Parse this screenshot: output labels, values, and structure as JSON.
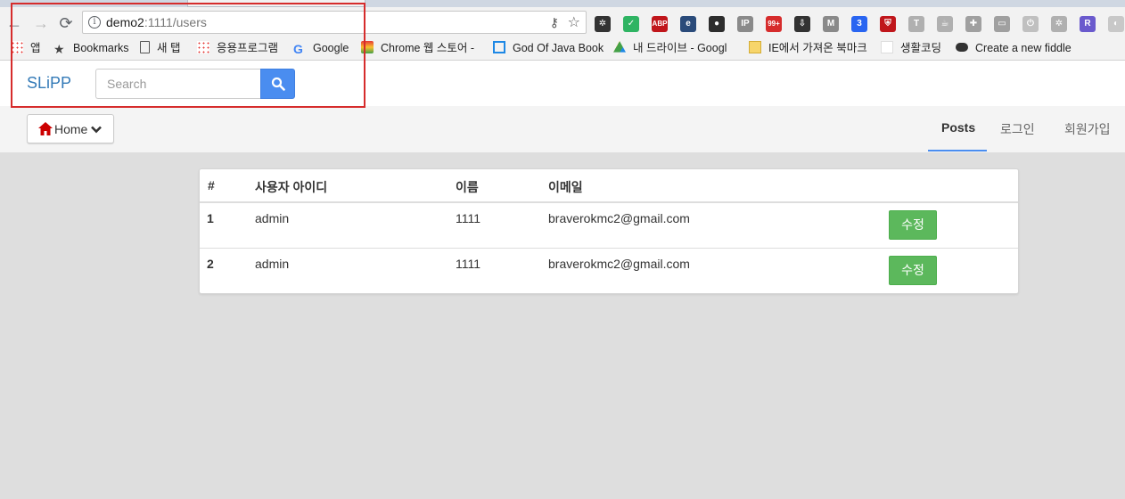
{
  "browser": {
    "url_host": "demo2",
    "url_rest": ":1111/users",
    "nav": {
      "back_icon": "←",
      "forward_icon": "→",
      "reload_icon": "⟳"
    },
    "extensions": [
      {
        "name": "gear-icon",
        "glyph": "✲",
        "color": "#333333"
      },
      {
        "name": "shield-check-icon",
        "glyph": "✓",
        "color": "#2fb463"
      },
      {
        "name": "adblock-icon",
        "glyph": "ABP",
        "color": "#c0161b"
      },
      {
        "name": "e-icon",
        "glyph": "e",
        "color": "#2a4b7a"
      },
      {
        "name": "person-icon",
        "glyph": "●",
        "color": "#2d2d2d"
      },
      {
        "name": "ip-icon",
        "glyph": "IP",
        "color": "#8a8a8a"
      },
      {
        "name": "notification-icon",
        "glyph": "99+",
        "color": "#d62c2c"
      },
      {
        "name": "download-icon",
        "glyph": "⇩",
        "color": "#333333"
      },
      {
        "name": "mail-icon",
        "glyph": "M",
        "color": "#8a8a8a"
      },
      {
        "name": "css3-icon",
        "glyph": "3",
        "color": "#2965f1"
      },
      {
        "name": "security-shield-icon",
        "glyph": "⛨",
        "color": "#c0161b"
      },
      {
        "name": "t-icon",
        "glyph": "T",
        "color": "#b0b0b0"
      },
      {
        "name": "java-icon",
        "glyph": "☕",
        "color": "#b0b0b0"
      },
      {
        "name": "puzzle-icon",
        "glyph": "✚",
        "color": "#a0a0a0"
      },
      {
        "name": "card-icon",
        "glyph": "▭",
        "color": "#a0a0a0"
      },
      {
        "name": "power-icon",
        "glyph": "⏻",
        "color": "#c0c0c0"
      },
      {
        "name": "settings-icon",
        "glyph": "✲",
        "color": "#b0b0b0"
      },
      {
        "name": "r-icon",
        "glyph": "R",
        "color": "#6a5acd"
      },
      {
        "name": "round-icon",
        "glyph": "◐",
        "color": "#c8c8c8"
      }
    ],
    "bookmarks": [
      {
        "label": "앱",
        "icon": "apps-icon"
      },
      {
        "label": "Bookmarks",
        "icon": "star-icon"
      },
      {
        "label": "새 탭",
        "icon": "page-icon"
      },
      {
        "label": "응용프로그램",
        "icon": "apps-icon"
      },
      {
        "label": "Google",
        "icon": "google-icon"
      },
      {
        "label": "Chrome 웹 스토어 -",
        "icon": "chrome-store-icon"
      },
      {
        "label": "God Of Java Book",
        "icon": "book-icon"
      },
      {
        "label": "내 드라이브 - Googl",
        "icon": "drive-icon"
      },
      {
        "label": "IE에서 가져온 북마크",
        "icon": "folder-icon"
      },
      {
        "label": "생활코딩",
        "icon": "blank-page-icon"
      },
      {
        "label": "Create a new fiddle",
        "icon": "cloud-icon"
      }
    ]
  },
  "app": {
    "brand": "SLiPP",
    "search": {
      "placeholder": "Search"
    },
    "home_label": "Home",
    "nav_links": [
      {
        "label": "Posts",
        "active": true
      },
      {
        "label": "로그인",
        "active": false
      },
      {
        "label": "회원가입",
        "active": false
      }
    ]
  },
  "table": {
    "columns": [
      "#",
      "사용자 아이디",
      "이름",
      "이메일"
    ],
    "rows": [
      {
        "num": "1",
        "user_id": "admin",
        "name": "1111",
        "email": "braverokmc2@gmail.com",
        "action": "수정"
      },
      {
        "num": "2",
        "user_id": "admin",
        "name": "1111",
        "email": "braverokmc2@gmail.com",
        "action": "수정"
      }
    ]
  },
  "colors": {
    "brand": "#337ab7",
    "search_button": "#4a8df0",
    "edit_button": "#5cb85c",
    "annotation_box": "#d62c2c",
    "home_icon": "#cc0000"
  }
}
